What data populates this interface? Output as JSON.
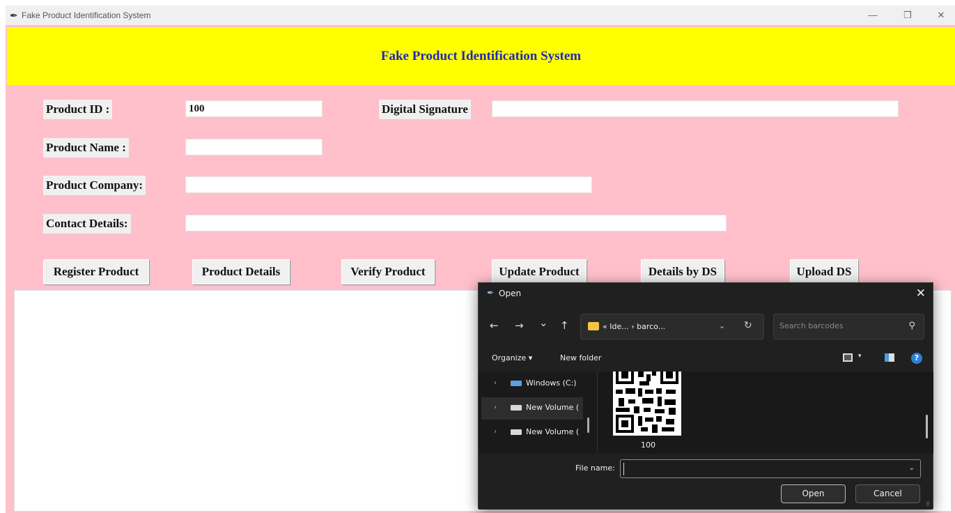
{
  "window": {
    "title": "Fake Product Identification System",
    "minimize": "—",
    "restore": "❐",
    "close": "✕"
  },
  "banner": {
    "heading": "Fake Product Identification System"
  },
  "colors": {
    "background": "#ffc0cb",
    "banner": "#ffff00",
    "heading_text": "#1f2ab3"
  },
  "form": {
    "product_id_label": "Product ID :",
    "product_id_value": "100",
    "digital_signature_label": "Digital Signature",
    "digital_signature_value": "",
    "product_name_label": "Product Name :",
    "product_name_value": "",
    "product_company_label": "Product Company:",
    "product_company_value": "",
    "contact_details_label": "Contact Details:",
    "contact_details_value": ""
  },
  "buttons": {
    "register": "Register Product",
    "details": "Product Details",
    "verify": "Verify Product",
    "update": "Update Product",
    "details_by_ds": "Details by DS",
    "upload_ds": "Upload DS"
  },
  "dialog": {
    "title": "Open",
    "close": "✕",
    "nav": {
      "back": "←",
      "forward": "→",
      "recent": "⌄",
      "up": "↑"
    },
    "address_path": "« Ide... › barco...",
    "address_chevron": "⌄",
    "refresh": "↻",
    "search_placeholder": "Search barcodes",
    "search_icon": "⚲",
    "organize": "Organize ▾",
    "new_folder": "New folder",
    "view_caret": "▾",
    "help": "?",
    "nav_items": [
      {
        "label": "Windows (C:)"
      },
      {
        "label": "New Volume ("
      },
      {
        "label": "New Volume ("
      }
    ],
    "nav_arrow": "›",
    "file_name_display": "100",
    "file_name_label": "File name:",
    "file_name_value": "",
    "file_name_dropdown": "⌄",
    "open_button": "Open",
    "cancel_button": "Cancel",
    "grip": "⠿"
  }
}
